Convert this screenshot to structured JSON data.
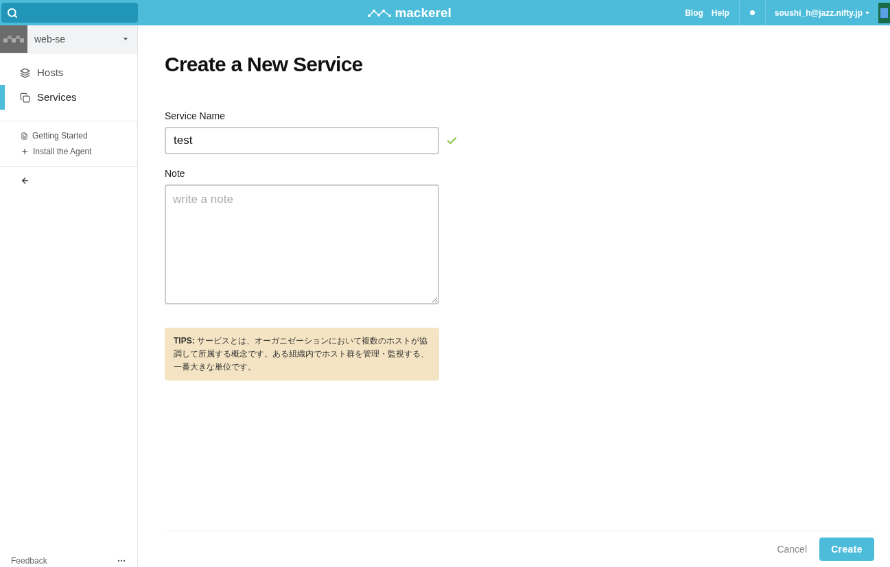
{
  "header": {
    "logo": "mackerel",
    "links": [
      "Blog",
      "Help"
    ],
    "user": "soushi_h@jazz.nifty.jp"
  },
  "sidebar": {
    "org": "web-se",
    "nav": [
      {
        "label": "Hosts",
        "kind": "hosts",
        "selected": false
      },
      {
        "label": "Services",
        "kind": "services",
        "selected": true
      }
    ],
    "links": [
      {
        "label": "Getting Started",
        "kind": "doc"
      },
      {
        "label": "Install the Agent",
        "kind": "plus"
      }
    ],
    "feedback": "Feedback"
  },
  "page": {
    "title": "Create a New Service",
    "service_name": {
      "label": "Service Name",
      "value": "test",
      "valid": true
    },
    "note": {
      "label": "Note",
      "placeholder": "write a note"
    },
    "tips": "**TIPS:** サービスとは、オーガニゼーションにおいて複数のホストが協調して所属する概念です。ある組織内でホスト群を管理・監視する、一番大きな単位です。",
    "buttons": {
      "cancel": "Cancel",
      "create": "Create"
    }
  }
}
